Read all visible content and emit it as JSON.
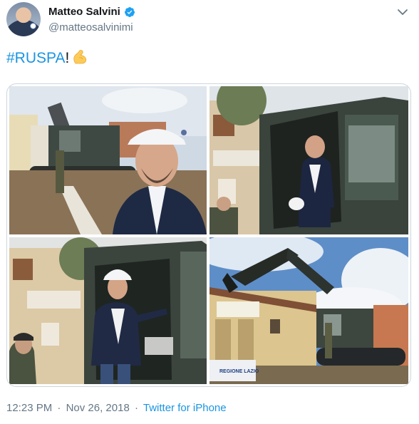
{
  "author": {
    "display_name": "Matteo Salvini",
    "handle": "@matteosalvinimi",
    "verified": true,
    "avatar_icon": "profile-photo"
  },
  "tweet": {
    "hashtag": "#RUSPA",
    "punctuation": "!",
    "emoji_icon": "flexed-biceps-icon"
  },
  "media": {
    "photo_count": 4,
    "sign_text": "REGIONE LAZIO"
  },
  "meta": {
    "time": "12:23 PM",
    "separator": "·",
    "date": "Nov 26, 2018",
    "source": "Twitter for iPhone"
  },
  "colors": {
    "link": "#1b95e0",
    "secondary_text": "#657786",
    "primary_text": "#14171a",
    "border": "#ccd6dd",
    "verified_badge": "#1da1f2"
  }
}
